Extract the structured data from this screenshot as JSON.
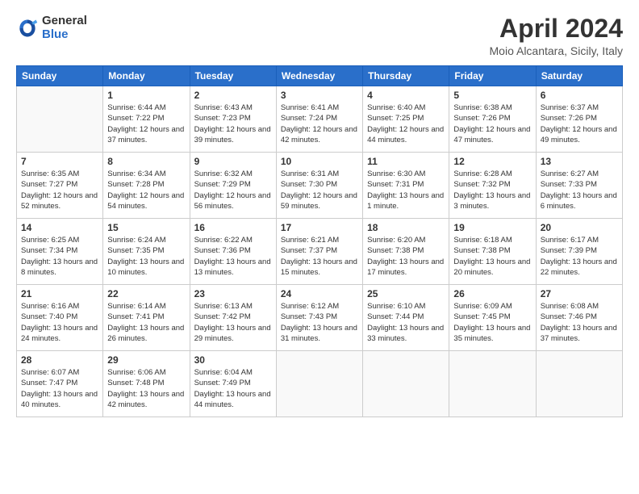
{
  "header": {
    "logo_general": "General",
    "logo_blue": "Blue",
    "title": "April 2024",
    "location": "Moio Alcantara, Sicily, Italy"
  },
  "weekdays": [
    "Sunday",
    "Monday",
    "Tuesday",
    "Wednesday",
    "Thursday",
    "Friday",
    "Saturday"
  ],
  "weeks": [
    [
      {
        "day": "",
        "sunrise": "",
        "sunset": "",
        "daylight": ""
      },
      {
        "day": "1",
        "sunrise": "Sunrise: 6:44 AM",
        "sunset": "Sunset: 7:22 PM",
        "daylight": "Daylight: 12 hours and 37 minutes."
      },
      {
        "day": "2",
        "sunrise": "Sunrise: 6:43 AM",
        "sunset": "Sunset: 7:23 PM",
        "daylight": "Daylight: 12 hours and 39 minutes."
      },
      {
        "day": "3",
        "sunrise": "Sunrise: 6:41 AM",
        "sunset": "Sunset: 7:24 PM",
        "daylight": "Daylight: 12 hours and 42 minutes."
      },
      {
        "day": "4",
        "sunrise": "Sunrise: 6:40 AM",
        "sunset": "Sunset: 7:25 PM",
        "daylight": "Daylight: 12 hours and 44 minutes."
      },
      {
        "day": "5",
        "sunrise": "Sunrise: 6:38 AM",
        "sunset": "Sunset: 7:26 PM",
        "daylight": "Daylight: 12 hours and 47 minutes."
      },
      {
        "day": "6",
        "sunrise": "Sunrise: 6:37 AM",
        "sunset": "Sunset: 7:26 PM",
        "daylight": "Daylight: 12 hours and 49 minutes."
      }
    ],
    [
      {
        "day": "7",
        "sunrise": "Sunrise: 6:35 AM",
        "sunset": "Sunset: 7:27 PM",
        "daylight": "Daylight: 12 hours and 52 minutes."
      },
      {
        "day": "8",
        "sunrise": "Sunrise: 6:34 AM",
        "sunset": "Sunset: 7:28 PM",
        "daylight": "Daylight: 12 hours and 54 minutes."
      },
      {
        "day": "9",
        "sunrise": "Sunrise: 6:32 AM",
        "sunset": "Sunset: 7:29 PM",
        "daylight": "Daylight: 12 hours and 56 minutes."
      },
      {
        "day": "10",
        "sunrise": "Sunrise: 6:31 AM",
        "sunset": "Sunset: 7:30 PM",
        "daylight": "Daylight: 12 hours and 59 minutes."
      },
      {
        "day": "11",
        "sunrise": "Sunrise: 6:30 AM",
        "sunset": "Sunset: 7:31 PM",
        "daylight": "Daylight: 13 hours and 1 minute."
      },
      {
        "day": "12",
        "sunrise": "Sunrise: 6:28 AM",
        "sunset": "Sunset: 7:32 PM",
        "daylight": "Daylight: 13 hours and 3 minutes."
      },
      {
        "day": "13",
        "sunrise": "Sunrise: 6:27 AM",
        "sunset": "Sunset: 7:33 PM",
        "daylight": "Daylight: 13 hours and 6 minutes."
      }
    ],
    [
      {
        "day": "14",
        "sunrise": "Sunrise: 6:25 AM",
        "sunset": "Sunset: 7:34 PM",
        "daylight": "Daylight: 13 hours and 8 minutes."
      },
      {
        "day": "15",
        "sunrise": "Sunrise: 6:24 AM",
        "sunset": "Sunset: 7:35 PM",
        "daylight": "Daylight: 13 hours and 10 minutes."
      },
      {
        "day": "16",
        "sunrise": "Sunrise: 6:22 AM",
        "sunset": "Sunset: 7:36 PM",
        "daylight": "Daylight: 13 hours and 13 minutes."
      },
      {
        "day": "17",
        "sunrise": "Sunrise: 6:21 AM",
        "sunset": "Sunset: 7:37 PM",
        "daylight": "Daylight: 13 hours and 15 minutes."
      },
      {
        "day": "18",
        "sunrise": "Sunrise: 6:20 AM",
        "sunset": "Sunset: 7:38 PM",
        "daylight": "Daylight: 13 hours and 17 minutes."
      },
      {
        "day": "19",
        "sunrise": "Sunrise: 6:18 AM",
        "sunset": "Sunset: 7:38 PM",
        "daylight": "Daylight: 13 hours and 20 minutes."
      },
      {
        "day": "20",
        "sunrise": "Sunrise: 6:17 AM",
        "sunset": "Sunset: 7:39 PM",
        "daylight": "Daylight: 13 hours and 22 minutes."
      }
    ],
    [
      {
        "day": "21",
        "sunrise": "Sunrise: 6:16 AM",
        "sunset": "Sunset: 7:40 PM",
        "daylight": "Daylight: 13 hours and 24 minutes."
      },
      {
        "day": "22",
        "sunrise": "Sunrise: 6:14 AM",
        "sunset": "Sunset: 7:41 PM",
        "daylight": "Daylight: 13 hours and 26 minutes."
      },
      {
        "day": "23",
        "sunrise": "Sunrise: 6:13 AM",
        "sunset": "Sunset: 7:42 PM",
        "daylight": "Daylight: 13 hours and 29 minutes."
      },
      {
        "day": "24",
        "sunrise": "Sunrise: 6:12 AM",
        "sunset": "Sunset: 7:43 PM",
        "daylight": "Daylight: 13 hours and 31 minutes."
      },
      {
        "day": "25",
        "sunrise": "Sunrise: 6:10 AM",
        "sunset": "Sunset: 7:44 PM",
        "daylight": "Daylight: 13 hours and 33 minutes."
      },
      {
        "day": "26",
        "sunrise": "Sunrise: 6:09 AM",
        "sunset": "Sunset: 7:45 PM",
        "daylight": "Daylight: 13 hours and 35 minutes."
      },
      {
        "day": "27",
        "sunrise": "Sunrise: 6:08 AM",
        "sunset": "Sunset: 7:46 PM",
        "daylight": "Daylight: 13 hours and 37 minutes."
      }
    ],
    [
      {
        "day": "28",
        "sunrise": "Sunrise: 6:07 AM",
        "sunset": "Sunset: 7:47 PM",
        "daylight": "Daylight: 13 hours and 40 minutes."
      },
      {
        "day": "29",
        "sunrise": "Sunrise: 6:06 AM",
        "sunset": "Sunset: 7:48 PM",
        "daylight": "Daylight: 13 hours and 42 minutes."
      },
      {
        "day": "30",
        "sunrise": "Sunrise: 6:04 AM",
        "sunset": "Sunset: 7:49 PM",
        "daylight": "Daylight: 13 hours and 44 minutes."
      },
      {
        "day": "",
        "sunrise": "",
        "sunset": "",
        "daylight": ""
      },
      {
        "day": "",
        "sunrise": "",
        "sunset": "",
        "daylight": ""
      },
      {
        "day": "",
        "sunrise": "",
        "sunset": "",
        "daylight": ""
      },
      {
        "day": "",
        "sunrise": "",
        "sunset": "",
        "daylight": ""
      }
    ]
  ]
}
